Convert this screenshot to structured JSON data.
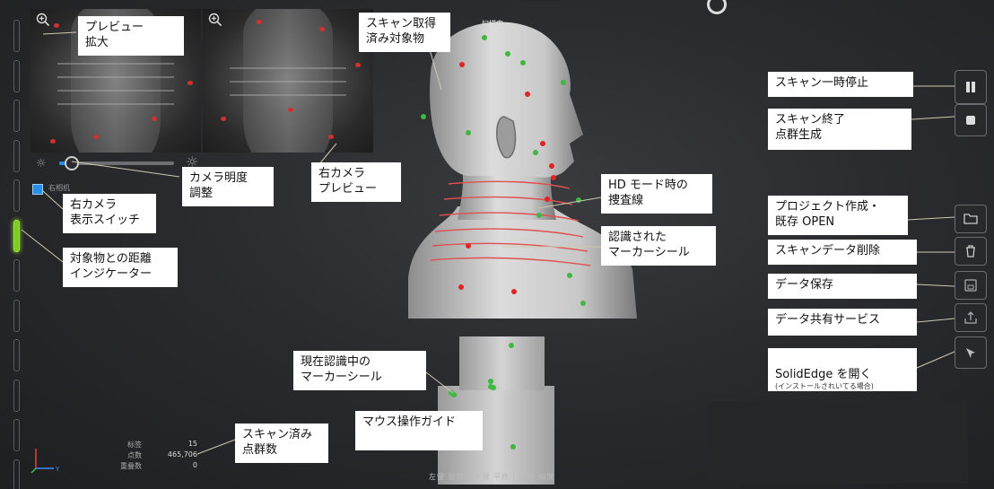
{
  "callouts": {
    "preview_zoom": "プレビュー\n拡大",
    "scanned_object": "スキャン取得\n済み対象物",
    "camera_brightness": "カメラ明度\n調整",
    "right_camera_preview": "右カメラ\nプレビュー",
    "right_camera_switch": "右カメラ\n表示スイッチ",
    "distance_indicator": "対象物との距離\nインジケーター",
    "hd_mode_lines": "HD モード時の\n捜査線",
    "recognized_markers": "認識された\nマーカーシール",
    "current_markers": "現在認識中の\nマーカーシール",
    "mouse_guide": "マウス操作ガイド",
    "scanned_points": "スキャン済み\n点群数",
    "pause": "スキャン一時停止",
    "finish": "スキャン終了\n点群生成",
    "project_open": "プロジェクト作成・\n既存 OPEN",
    "delete_data": "スキャンデータ削除",
    "save_data": "データ保存",
    "share_service": "データ共有サービス",
    "open_solidedge": "SolidEdge を開く",
    "open_solidedge_note": "(インストールされいてる場合)"
  },
  "status": {
    "scanning": "扫描中"
  },
  "right_camera_toggle": {
    "label": "右相机",
    "checked": true
  },
  "brightness_level": 0.12,
  "stats": {
    "labels": [
      "标签",
      "点数",
      "重叠数"
    ],
    "values": [
      "15",
      "465,706",
      "0"
    ]
  },
  "mouse_guide_bar": "左键 旋转 | 中键 平移 | 滚轮 缩放",
  "distance_indicator": {
    "segments": 12,
    "active_index": 5
  },
  "colors": {
    "marker_red": "#e02424",
    "marker_green": "#3fb83f",
    "scan_lines": "#e05050",
    "indicator_green": "#7bcc22",
    "accent_blue": "#2a8ee8"
  },
  "icons": {
    "pause": "pause-icon",
    "stop": "stop-icon",
    "folder": "folder-icon",
    "trash": "trash-icon",
    "save": "save-icon",
    "share": "share-icon",
    "solidedge": "solidedge-icon",
    "zoom": "zoom-in-icon",
    "sun": "sun-icon"
  }
}
